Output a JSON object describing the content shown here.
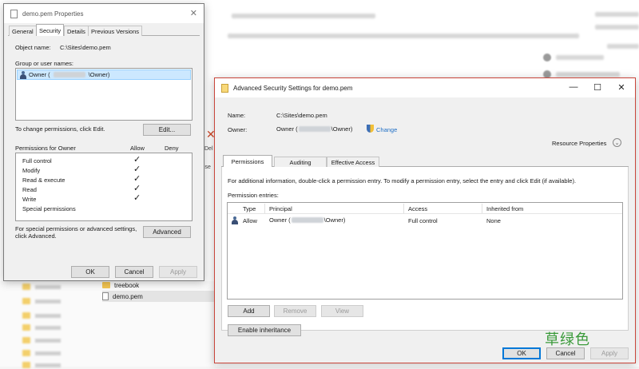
{
  "background": {
    "explorer_items": [
      {
        "name": "treebook",
        "icon": "folder-icon"
      },
      {
        "name": "demo.pem",
        "icon": "file-icon",
        "selected": true
      }
    ],
    "delete_label": "Del",
    "delete_label2": "ise"
  },
  "props_dialog": {
    "title": "demo.pem Properties",
    "tabs": [
      "General",
      "Security",
      "Details",
      "Previous Versions"
    ],
    "active_tab": "Security",
    "object_name_label": "Object name:",
    "object_name_value": "C:\\Sites\\demo.pem",
    "group_label": "Group or user names:",
    "users": [
      {
        "prefix": "Owner (",
        "suffix": "\\Owner)"
      }
    ],
    "change_text": "To change permissions, click Edit.",
    "edit_button": "Edit...",
    "perm_header": "Permissions for Owner",
    "allow_header": "Allow",
    "deny_header": "Deny",
    "permissions": [
      {
        "name": "Full control",
        "allow": true
      },
      {
        "name": "Modify",
        "allow": true
      },
      {
        "name": "Read & execute",
        "allow": true
      },
      {
        "name": "Read",
        "allow": true
      },
      {
        "name": "Write",
        "allow": true
      },
      {
        "name": "Special permissions",
        "allow": false
      }
    ],
    "special_text_1": "For special permissions or advanced settings,",
    "special_text_2": "click Advanced.",
    "advanced_button": "Advanced",
    "ok": "OK",
    "cancel": "Cancel",
    "apply": "Apply"
  },
  "adv_dialog": {
    "title": "Advanced Security Settings for demo.pem",
    "name_label": "Name:",
    "name_value": "C:\\Sites\\demo.pem",
    "owner_label": "Owner:",
    "owner_prefix": "Owner (",
    "owner_suffix": "\\Owner)",
    "change_link": "Change",
    "resource_props": "Resource Properties",
    "tabs": [
      "Permissions",
      "Auditing",
      "Effective Access"
    ],
    "active_tab": "Permissions",
    "info_text": "For additional information, double-click a permission entry. To modify a permission entry, select the entry and click Edit (if available).",
    "entries_label": "Permission entries:",
    "columns": [
      "Type",
      "Principal",
      "Access",
      "Inherited from"
    ],
    "rows": [
      {
        "type": "Allow",
        "principal_prefix": "Owner (",
        "principal_suffix": "\\Owner)",
        "access": "Full control",
        "inherited": "None"
      }
    ],
    "add": "Add",
    "remove": "Remove",
    "view": "View",
    "enable_inheritance": "Enable inheritance",
    "ok": "OK",
    "cancel": "Cancel",
    "apply": "Apply"
  },
  "watermark": "草绿色"
}
